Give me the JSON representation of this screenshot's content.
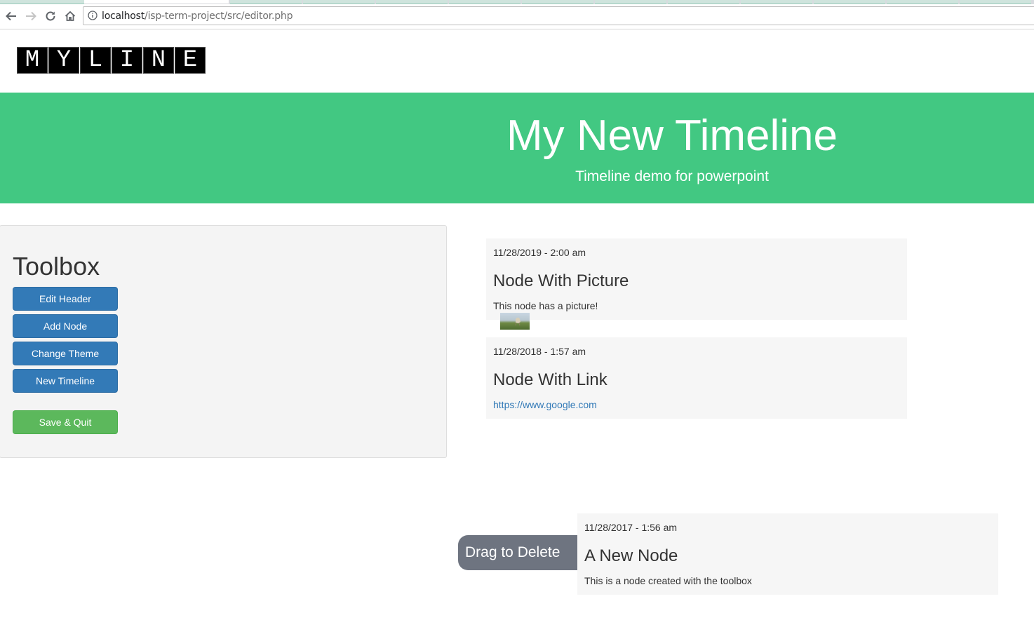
{
  "browser": {
    "url_host": "localhost",
    "url_path": "/isp-term-project/src/editor.php"
  },
  "logo": {
    "letters": [
      "M",
      "Y",
      "L",
      "I",
      "N",
      "E"
    ]
  },
  "header": {
    "title": "My New Timeline",
    "subtitle": "Timeline demo for powerpoint",
    "accent_color": "#42c882"
  },
  "toolbox": {
    "title": "Toolbox",
    "buttons": {
      "edit_header": "Edit Header",
      "add_node": "Add Node",
      "change_theme": "Change Theme",
      "new_timeline": "New Timeline",
      "save_quit": "Save & Quit"
    }
  },
  "nodes": [
    {
      "date": "11/28/2019 - 2:00 am",
      "title": "Node With Picture",
      "body": "This node has a picture!",
      "has_image": true
    },
    {
      "date": "11/28/2018 - 1:57 am",
      "title": "Node With Link",
      "link": "https://www.google.com"
    },
    {
      "date": "11/28/2017 - 1:56 am",
      "title": "A New Node",
      "body": "This is a node created with the toolbox"
    }
  ],
  "drag_delete": {
    "label": "Drag to Delete"
  },
  "icons": [
    "back-arrow-icon",
    "forward-arrow-icon",
    "reload-icon",
    "home-icon",
    "info-icon"
  ]
}
